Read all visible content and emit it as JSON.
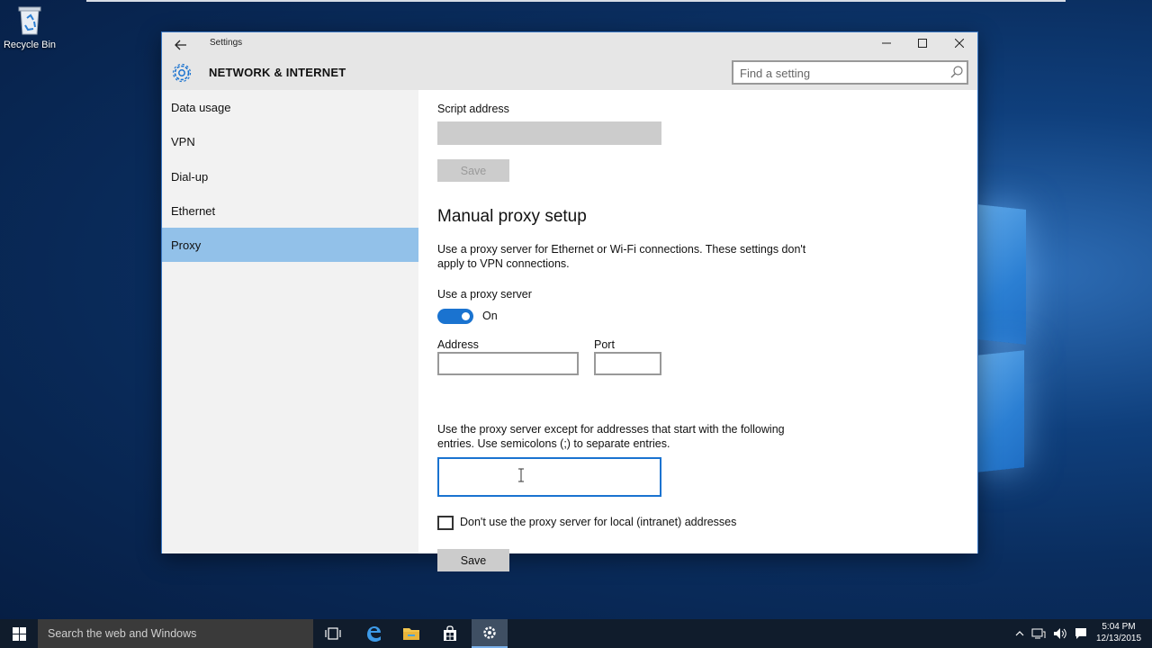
{
  "desktop": {
    "recycle_bin_label": "Recycle Bin"
  },
  "window": {
    "title": "Settings",
    "section_title": "NETWORK & INTERNET",
    "search_placeholder": "Find a setting"
  },
  "sidebar": {
    "items": [
      {
        "label": "Data usage",
        "active": false
      },
      {
        "label": "VPN",
        "active": false
      },
      {
        "label": "Dial-up",
        "active": false
      },
      {
        "label": "Ethernet",
        "active": false
      },
      {
        "label": "Proxy",
        "active": true
      }
    ]
  },
  "content": {
    "script_address_label": "Script address",
    "script_address_value": "",
    "script_save_label": "Save",
    "manual_heading": "Manual proxy setup",
    "manual_description": "Use a proxy server for Ethernet or Wi-Fi connections. These settings don't apply to VPN connections.",
    "use_proxy_label": "Use a proxy server",
    "use_proxy_state": "On",
    "address_label": "Address",
    "address_value": "",
    "port_label": "Port",
    "port_value": "",
    "exceptions_description": "Use the proxy server except for addresses that start with the following entries. Use semicolons (;) to separate entries.",
    "exceptions_value": "",
    "local_checkbox_label": "Don't use the proxy server for local (intranet) addresses",
    "local_checkbox_checked": false,
    "save_label": "Save"
  },
  "taskbar": {
    "search_placeholder": "Search the web and Windows",
    "time": "5:04 PM",
    "date": "12/13/2015"
  },
  "colors": {
    "accent": "#1a73d0",
    "sidebar_active": "#92c1e9",
    "sidebar_bg": "#f2f2f2",
    "button_bg": "#cccccc"
  }
}
